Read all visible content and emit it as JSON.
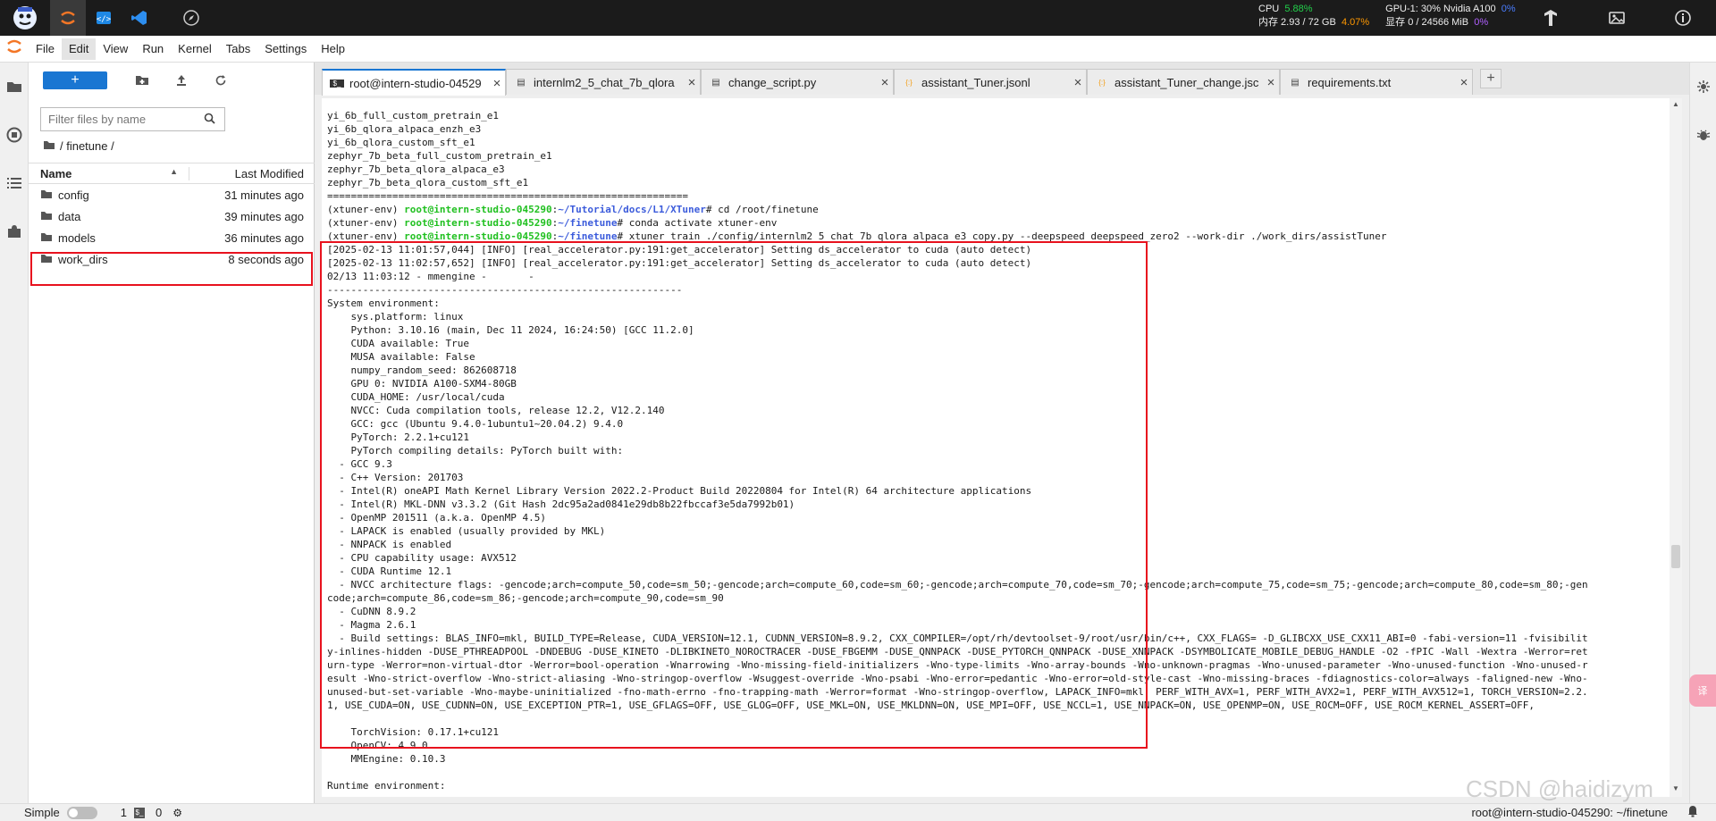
{
  "sysbar": {
    "cpu_label": "CPU",
    "cpu_value": "5.88%",
    "mem_label": "内存 2.93 / 72 GB",
    "mem_value": "4.07%",
    "gpu_label": "GPU-1: 30% Nvidia A100",
    "gpu_value": "0%",
    "vram_label": "显存 0 / 24566 MiB",
    "vram_value": "0%",
    "colors": {
      "green": "#22d14b",
      "orange": "#ff9800",
      "blue": "#4a7dff",
      "purple": "#b060ff"
    }
  },
  "menubar": {
    "items": [
      "File",
      "Edit",
      "View",
      "Run",
      "Kernel",
      "Tabs",
      "Settings",
      "Help"
    ]
  },
  "filebrowser": {
    "new_label": "+",
    "search_placeholder": "Filter files by name",
    "breadcrumb": "/ finetune /",
    "header_name": "Name",
    "header_modified": "Last Modified",
    "files": [
      {
        "name": "config",
        "modified": "31 minutes ago"
      },
      {
        "name": "data",
        "modified": "39 minutes ago"
      },
      {
        "name": "models",
        "modified": "36 minutes ago"
      },
      {
        "name": "work_dirs",
        "modified": "8 seconds ago"
      }
    ]
  },
  "tabs": [
    {
      "label": "root@intern-studio-04529",
      "icon": "$_"
    },
    {
      "label": "internlm2_5_chat_7b_qlora",
      "icon": "▤"
    },
    {
      "label": "change_script.py",
      "icon": "▤"
    },
    {
      "label": "assistant_Tuner.jsonl",
      "icon": "{:}"
    },
    {
      "label": "assistant_Tuner_change.jsc",
      "icon": "{:}"
    },
    {
      "label": "requirements.txt",
      "icon": "▤"
    }
  ],
  "terminal": {
    "lines": [
      "yi_6b_full_custom_pretrain_e1",
      "yi_6b_qlora_alpaca_enzh_e3",
      "yi_6b_qlora_custom_sft_e1",
      "zephyr_7b_beta_full_custom_pretrain_e1",
      "zephyr_7b_beta_qlora_alpaca_e3",
      "zephyr_7b_beta_qlora_custom_sft_e1",
      "=============================================================",
      "",
      "",
      "",
      "[2025-02-13 11:01:57,044] [INFO] [real_accelerator.py:191:get_accelerator] Setting ds_accelerator to cuda (auto detect)",
      "[2025-02-13 11:02:57,652] [INFO] [real_accelerator.py:191:get_accelerator] Setting ds_accelerator to cuda (auto detect)",
      "02/13 11:03:12 - mmengine -       -",
      "------------------------------------------------------------",
      "System environment:",
      "    sys.platform: linux",
      "    Python: 3.10.16 (main, Dec 11 2024, 16:24:50) [GCC 11.2.0]",
      "    CUDA available: True",
      "    MUSA available: False",
      "    numpy_random_seed: 862608718",
      "    GPU 0: NVIDIA A100-SXM4-80GB",
      "    CUDA_HOME: /usr/local/cuda",
      "    NVCC: Cuda compilation tools, release 12.2, V12.2.140",
      "    GCC: gcc (Ubuntu 9.4.0-1ubuntu1~20.04.2) 9.4.0",
      "    PyTorch: 2.2.1+cu121",
      "    PyTorch compiling details: PyTorch built with:",
      "  - GCC 9.3",
      "  - C++ Version: 201703",
      "  - Intel(R) oneAPI Math Kernel Library Version 2022.2-Product Build 20220804 for Intel(R) 64 architecture applications",
      "  - Intel(R) MKL-DNN v3.3.2 (Git Hash 2dc95a2ad0841e29db8b22fbccaf3e5da7992b01)",
      "  - OpenMP 201511 (a.k.a. OpenMP 4.5)",
      "  - LAPACK is enabled (usually provided by MKL)",
      "  - NNPACK is enabled",
      "  - CPU capability usage: AVX512",
      "  - CUDA Runtime 12.1",
      "  - NVCC architecture flags: -gencode;arch=compute_50,code=sm_50;-gencode;arch=compute_60,code=sm_60;-gencode;arch=compute_70,code=sm_70;-gencode;arch=compute_75,code=sm_75;-gencode;arch=compute_80,code=sm_80;-gen",
      "code;arch=compute_86,code=sm_86;-gencode;arch=compute_90,code=sm_90",
      "  - CuDNN 8.9.2",
      "  - Magma 2.6.1",
      "  - Build settings: BLAS_INFO=mkl, BUILD_TYPE=Release, CUDA_VERSION=12.1, CUDNN_VERSION=8.9.2, CXX_COMPILER=/opt/rh/devtoolset-9/root/usr/bin/c++, CXX_FLAGS= -D_GLIBCXX_USE_CXX11_ABI=0 -fabi-version=11 -fvisibilit",
      "y-inlines-hidden -DUSE_PTHREADPOOL -DNDEBUG -DUSE_KINETO -DLIBKINETO_NOROCTRACER -DUSE_FBGEMM -DUSE_QNNPACK -DUSE_PYTORCH_QNNPACK -DUSE_XNNPACK -DSYMBOLICATE_MOBILE_DEBUG_HANDLE -O2 -fPIC -Wall -Wextra -Werror=ret",
      "urn-type -Werror=non-virtual-dtor -Werror=bool-operation -Wnarrowing -Wno-missing-field-initializers -Wno-type-limits -Wno-array-bounds -Wno-unknown-pragmas -Wno-unused-parameter -Wno-unused-function -Wno-unused-r",
      "esult -Wno-strict-overflow -Wno-strict-aliasing -Wno-stringop-overflow -Wsuggest-override -Wno-psabi -Wno-error=pedantic -Wno-error=old-style-cast -Wno-missing-braces -fdiagnostics-color=always -faligned-new -Wno-",
      "unused-but-set-variable -Wno-maybe-uninitialized -fno-math-errno -fno-trapping-math -Werror=format -Wno-stringop-overflow, LAPACK_INFO=mkl, PERF_WITH_AVX=1, PERF_WITH_AVX2=1, PERF_WITH_AVX512=1, TORCH_VERSION=2.2.",
      "1, USE_CUDA=ON, USE_CUDNN=ON, USE_EXCEPTION_PTR=1, USE_GFLAGS=OFF, USE_GLOG=OFF, USE_MKL=ON, USE_MKLDNN=ON, USE_MPI=OFF, USE_NCCL=1, USE_NNPACK=ON, USE_OPENMP=ON, USE_ROCM=OFF, USE_ROCM_KERNEL_ASSERT=OFF,",
      "",
      "    TorchVision: 0.17.1+cu121",
      "    OpenCV: 4.9.0",
      "    MMEngine: 0.10.3",
      "",
      "Runtime environment:"
    ],
    "prompts": [
      {
        "env": "(xtuner-env) ",
        "user": "root@intern-studio-045290",
        "path": "~/Tutorial/docs/L1/XTuner",
        "cmd": "# cd /root/finetune"
      },
      {
        "env": "(xtuner-env) ",
        "user": "root@intern-studio-045290",
        "path": "~/finetune",
        "cmd": "# conda activate xtuner-env"
      },
      {
        "env": "(xtuner-env) ",
        "user": "root@intern-studio-045290",
        "path": "~/finetune",
        "cmd": "# xtuner train ./config/internlm2_5_chat_7b_qlora_alpaca_e3_copy.py --deepspeed deepspeed_zero2 --work-dir ./work_dirs/assistTuner"
      }
    ]
  },
  "statusbar": {
    "mode": "Simple",
    "count1": "1",
    "count2": "0",
    "path": "root@intern-studio-045290: ~/finetune"
  },
  "watermark": "CSDN @haidizym",
  "floating_badge": "译"
}
